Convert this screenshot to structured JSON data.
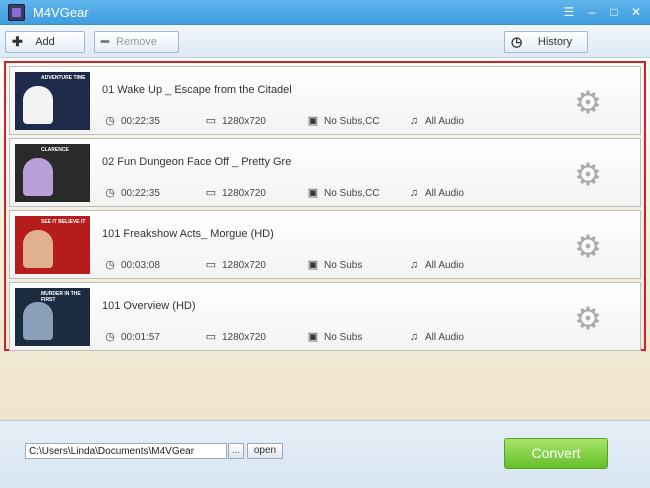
{
  "window": {
    "title": "M4VGear",
    "controls": [
      "menu-icon",
      "minimize-icon",
      "maximize-icon",
      "close-icon"
    ]
  },
  "toolbar": {
    "add_label": "Add",
    "remove_label": "Remove",
    "history_label": "History"
  },
  "items": [
    {
      "thumb_label": "ADVENTURE TIME",
      "thumb_bg": "#1e2a4a",
      "thumb_art": "#f3f3f3",
      "title": "01 Wake Up _ Escape from the Citadel",
      "duration": "00:22:35",
      "resolution": "1280x720",
      "subs": "No Subs,CC",
      "audio": "All Audio"
    },
    {
      "thumb_label": "CLARENCE",
      "thumb_bg": "#2a2a2a",
      "thumb_art": "#b8a0d8",
      "title": "02 Fun Dungeon Face Off _ Pretty Gre",
      "duration": "00:22:35",
      "resolution": "1280x720",
      "subs": "No Subs,CC",
      "audio": "All Audio"
    },
    {
      "thumb_label": "SEE IT BELIEVE IT",
      "thumb_bg": "#b51d1d",
      "thumb_art": "#e0b090",
      "title": "101 Freakshow Acts_ Morgue (HD)",
      "duration": "00:03:08",
      "resolution": "1280x720",
      "subs": "No Subs",
      "audio": "All Audio"
    },
    {
      "thumb_label": "MURDER IN THE FIRST",
      "thumb_bg": "#1c2c40",
      "thumb_art": "#8aa0b8",
      "title": "101 Overview (HD)",
      "duration": "00:01:57",
      "resolution": "1280x720",
      "subs": "No Subs",
      "audio": "All Audio"
    }
  ],
  "output": {
    "path": "C:\\Users\\Linda\\Documents\\M4VGear",
    "browse_label": "…",
    "open_label": "open"
  },
  "convert_label": "Convert",
  "colors": {
    "titlebar": "#4aa7e6",
    "selection_border": "#c8252b",
    "convert_button": "#7cd13c"
  }
}
